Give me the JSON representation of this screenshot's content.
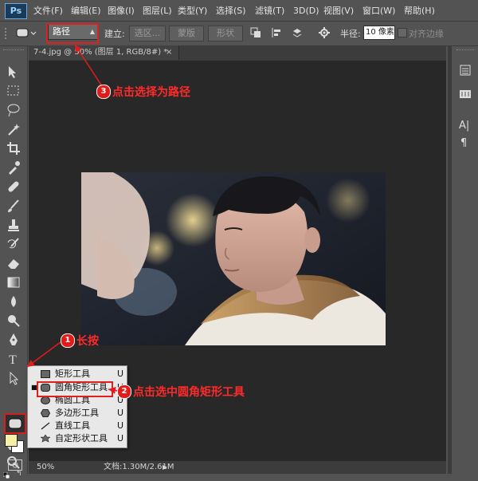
{
  "app": {
    "logo": "Ps"
  },
  "menu": [
    "文件(F)",
    "编辑(E)",
    "图像(I)",
    "图层(L)",
    "类型(Y)",
    "选择(S)",
    "滤镜(T)",
    "3D(D)",
    "视图(V)",
    "窗口(W)",
    "帮助(H)"
  ],
  "options": {
    "mode_value": "路径",
    "build_label": "建立:",
    "selection_btn": "选区...",
    "mask_btn": "蒙版",
    "shape_btn": "形状",
    "radius_label": "半径:",
    "radius_value": "10 像素",
    "align_edges_label": "对齐边缘"
  },
  "document": {
    "tab_title": "7-4.jpg @ 50% (图层 1, RGB/8#) *",
    "close_glyph": "×"
  },
  "status": {
    "zoom": "50%",
    "doc_info": "文档:1.30M/2.61M"
  },
  "flyout": {
    "items": [
      {
        "label": "矩形工具",
        "shortcut": "U",
        "icon": "rectangle-icon",
        "active": false
      },
      {
        "label": "圆角矩形工具",
        "shortcut": "U",
        "icon": "rounded-rectangle-icon",
        "active": true
      },
      {
        "label": "椭圆工具",
        "shortcut": "U",
        "icon": "ellipse-icon",
        "active": false
      },
      {
        "label": "多边形工具",
        "shortcut": "U",
        "icon": "polygon-icon",
        "active": false
      },
      {
        "label": "直线工具",
        "shortcut": "U",
        "icon": "line-icon",
        "active": false
      },
      {
        "label": "自定形状工具",
        "shortcut": "U",
        "icon": "custom-shape-icon",
        "active": false
      }
    ]
  },
  "annotations": [
    {
      "num": "1",
      "text": "长按"
    },
    {
      "num": "2",
      "text": "点击选中圆角矩形工具"
    },
    {
      "num": "3",
      "text": "点击选择为路径"
    }
  ],
  "colors": {
    "annotation_red": "#e31b1b",
    "foreground": "#f6f0a6",
    "background": "#ffffff"
  }
}
